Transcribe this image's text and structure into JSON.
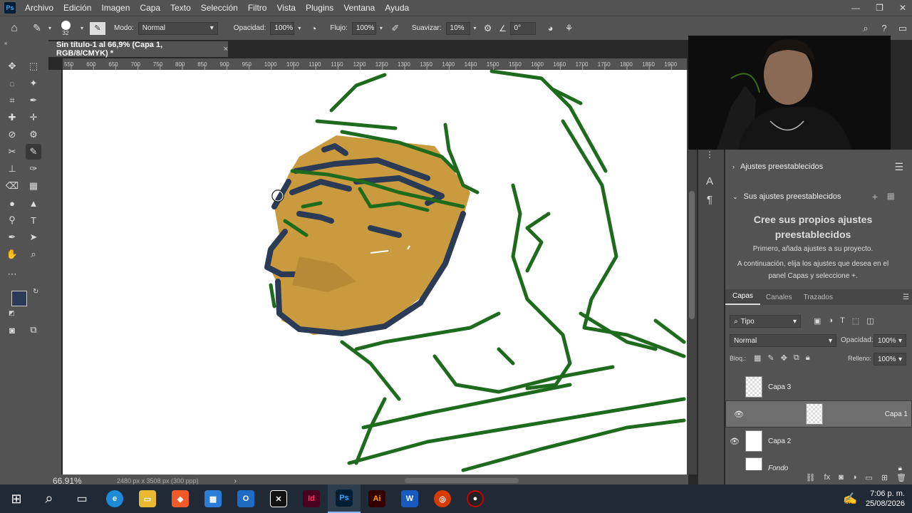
{
  "menu": [
    "Archivo",
    "Edición",
    "Imagen",
    "Capa",
    "Texto",
    "Selección",
    "Filtro",
    "Vista",
    "Plugins",
    "Ventana",
    "Ayuda"
  ],
  "app_logo": "Ps",
  "window_buttons": [
    "—",
    "❐",
    "✕"
  ],
  "options": {
    "brush_size": "32",
    "mode_label": "Modo:",
    "mode_value": "Normal",
    "opacity_label": "Opacidad:",
    "opacity_value": "100%",
    "flow_label": "Flujo:",
    "flow_value": "100%",
    "smooth_label": "Suavizar:",
    "smooth_value": "10%",
    "angle_value": "0°"
  },
  "document": {
    "tab_title": "Sin título-1 al 66,9% (Capa 1, RGB/8/CMYK) *",
    "zoom": "66.91%",
    "doc_info": "2480 px x 3508 px (300 ppp)"
  },
  "ruler_ticks": [
    "550",
    "600",
    "650",
    "700",
    "750",
    "800",
    "850",
    "900",
    "950",
    "1000",
    "1050",
    "1100",
    "1150",
    "1200",
    "1250",
    "1300",
    "1350",
    "1400",
    "1450",
    "1500",
    "1550",
    "1600",
    "1650",
    "1700",
    "1750",
    "1800",
    "1850",
    "1900"
  ],
  "presets": {
    "header": "Ajustes preestablecidos",
    "sub_header": "Sus ajustes preestablecidos",
    "title": "Cree sus propios ajustes preestablecidos",
    "line1": "Primero, añada ajustes a su proyecto.",
    "line2": "A continuación, elija los ajustes que desea en el panel Capas y seleccione",
    "plus": "+."
  },
  "layers_panel": {
    "tabs": [
      "Capas",
      "Canales",
      "Trazados"
    ],
    "filter": "Tipo",
    "blend_mode": "Normal",
    "opacity_label": "Opacidad:",
    "opacity_value": "100%",
    "lock_label": "Bloq.:",
    "fill_label": "Relleno:",
    "fill_value": "100%",
    "layers": [
      "Capa 3",
      "Capa 1",
      "Capa 2",
      "Fondo"
    ]
  },
  "colors": {
    "foreground": "#2b3a55",
    "background": "#ffffff",
    "sketch_green": "#1e6b1e",
    "skin": "#c99a3e",
    "navy": "#2b3a55"
  },
  "clock": {
    "time": "7:06 p. m.",
    "date": "25/08/2026"
  }
}
